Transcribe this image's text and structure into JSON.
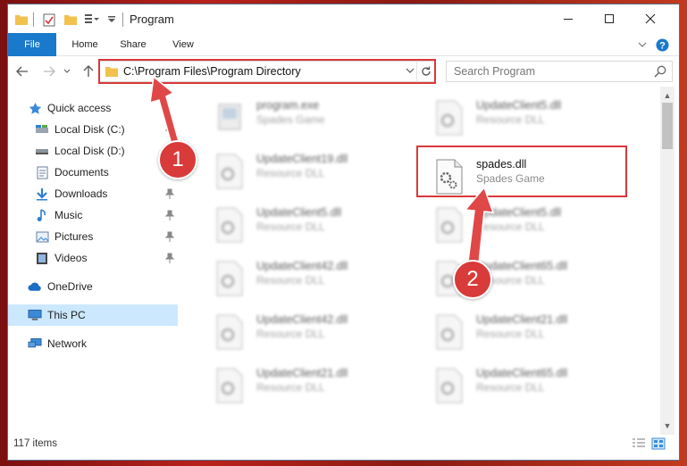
{
  "window": {
    "title": "Program"
  },
  "ribbon": {
    "tabs": [
      "File",
      "Home",
      "Share",
      "View"
    ]
  },
  "address": {
    "path": "C:\\Program Files\\Program Directory"
  },
  "search": {
    "placeholder": "Search Program"
  },
  "sidebar": {
    "items": [
      {
        "label": "Quick access",
        "icon": "star-icon"
      },
      {
        "label": "Local Disk (C:)",
        "icon": "drive-icon"
      },
      {
        "label": "Local Disk (D:)",
        "icon": "drive-icon"
      },
      {
        "label": "Documents",
        "icon": "documents-icon"
      },
      {
        "label": "Downloads",
        "icon": "download-icon"
      },
      {
        "label": "Music",
        "icon": "music-icon"
      },
      {
        "label": "Pictures",
        "icon": "pictures-icon"
      },
      {
        "label": "Videos",
        "icon": "videos-icon"
      },
      {
        "label": "OneDrive",
        "icon": "cloud-icon"
      },
      {
        "label": "This PC",
        "icon": "computer-icon"
      },
      {
        "label": "Network",
        "icon": "network-icon"
      }
    ]
  },
  "files": {
    "left": [
      {
        "name": "program.exe",
        "desc": "Spades Game"
      },
      {
        "name": "UpdateClient19.dll",
        "desc": "Resource DLL"
      },
      {
        "name": "UpdateClient5.dll",
        "desc": "Resource DLL"
      },
      {
        "name": "UpdateClient42.dll",
        "desc": "Resource DLL"
      },
      {
        "name": "UpdateClient42.dll",
        "desc": "Resource DLL"
      },
      {
        "name": "UpdateClient21.dll",
        "desc": "Resource DLL"
      }
    ],
    "right": [
      {
        "name": "UpdateClient5.dll",
        "desc": "Resource DLL"
      },
      {
        "name": "spades.dll",
        "desc": "Spades Game"
      },
      {
        "name": "UpdateClient5.dll",
        "desc": "Resource DLL"
      },
      {
        "name": "UpdateClient65.dll",
        "desc": "Resource DLL"
      },
      {
        "name": "UpdateClient21.dll",
        "desc": "Resource DLL"
      },
      {
        "name": "UpdateClient65.dll",
        "desc": "Resource DLL"
      }
    ]
  },
  "status": {
    "count": "117 items"
  },
  "annotations": {
    "step1": "1",
    "step2": "2",
    "color": "#d9383a"
  }
}
